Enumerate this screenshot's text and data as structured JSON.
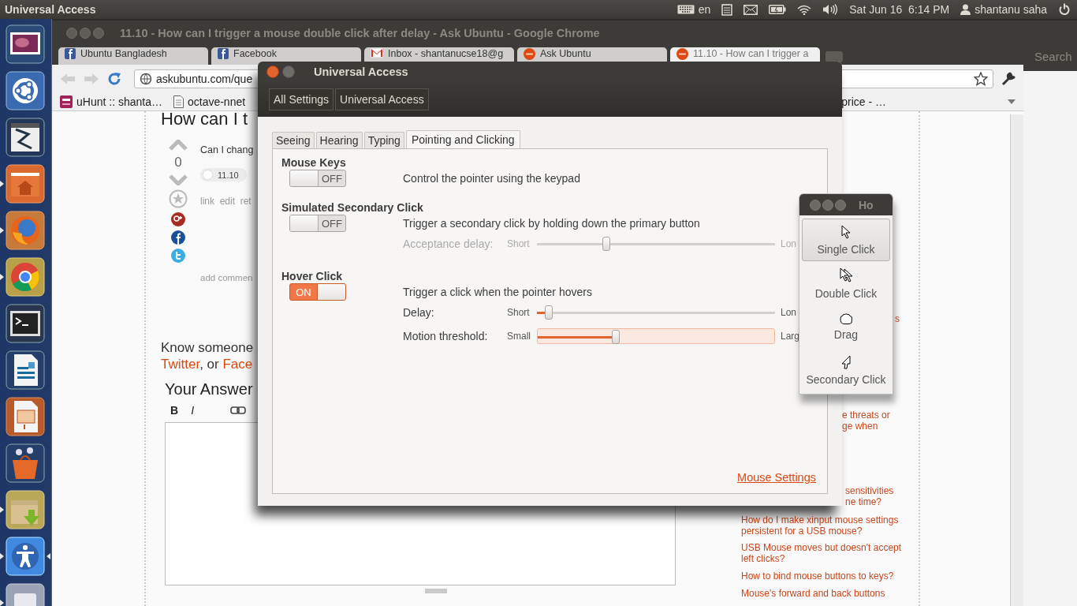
{
  "top_panel": {
    "app_title": "Universal Access",
    "keyboard_layout": "en",
    "clock": "Sat Jun 16  6:14 PM",
    "user": "shantanu saha"
  },
  "launcher": [
    {
      "kind": "workspaces",
      "running": false,
      "focused": false
    },
    {
      "kind": "dash",
      "running": false,
      "focused": false
    },
    {
      "kind": "remote",
      "running": false,
      "focused": false
    },
    {
      "kind": "files",
      "running": true,
      "focused": false
    },
    {
      "kind": "firefox",
      "running": true,
      "focused": false
    },
    {
      "kind": "chrome",
      "running": true,
      "focused": false
    },
    {
      "kind": "terminal",
      "running": false,
      "focused": false
    },
    {
      "kind": "writer",
      "running": false,
      "focused": false
    },
    {
      "kind": "impress",
      "running": false,
      "focused": false
    },
    {
      "kind": "software",
      "running": false,
      "focused": false
    },
    {
      "kind": "archive",
      "running": true,
      "focused": false
    },
    {
      "kind": "accessibility",
      "running": true,
      "focused": true
    },
    {
      "kind": "drive",
      "running": true,
      "focused": false
    }
  ],
  "browser": {
    "title": "11.10 - How can I trigger a mouse double click after delay - Ask Ubuntu - Google Chrome",
    "tabs": [
      {
        "label": "Ubuntu Bangladesh",
        "selected": false
      },
      {
        "label": "Facebook",
        "selected": false
      },
      {
        "label": "Inbox - shantanucse18@g",
        "selected": false
      },
      {
        "label": "Ask Ubuntu",
        "selected": false
      },
      {
        "label": "11.10 - How can I trigger a",
        "selected": true
      }
    ],
    "address": "askubuntu.com/que",
    "bookmarks": [
      "uHunt :: shanta…",
      "octave-nnet",
      "price - …"
    ],
    "question": {
      "heading": "How can I t",
      "votes": "0",
      "body": "Can I chang",
      "tag": "11.10",
      "actions": "link  edit  ret",
      "comment": "add commen"
    },
    "share_text": "Know someone",
    "share_links": [
      "Twitter",
      "Face"
    ],
    "share_joiner": ", or ",
    "answer_heading": "Your Answer",
    "editor_buttons": [
      "B",
      "I"
    ],
    "sidebar": [
      {
        "kind": "fragment",
        "text": "s"
      },
      {
        "kind": "fragment",
        "text": "e threats or\nge when"
      },
      {
        "kind": "fragment",
        "text": "sensitivities\nne time?"
      },
      {
        "kind": "link",
        "text": "How do I make xinput mouse settings persistent for a USB mouse?"
      },
      {
        "kind": "link",
        "text": "USB Mouse moves but doesn't accept left clicks?"
      },
      {
        "kind": "link",
        "text": "How to bind mouse buttons to keys?"
      },
      {
        "kind": "link",
        "text": "Mouse's forward and back buttons"
      }
    ]
  },
  "background_window": {
    "search": "Search"
  },
  "dialog": {
    "title": "Universal Access",
    "breadcrumbs": [
      "All Settings",
      "Universal Access"
    ],
    "tabs": [
      {
        "label": "Seeing",
        "selected": false
      },
      {
        "label": "Hearing",
        "selected": false
      },
      {
        "label": "Typing",
        "selected": false
      },
      {
        "label": "Pointing and Clicking",
        "selected": true
      }
    ],
    "sections": [
      {
        "title": "Mouse Keys",
        "on": false,
        "switch_label": "OFF",
        "description": "Control the pointer using the keypad"
      },
      {
        "title": "Simulated Secondary Click",
        "on": false,
        "switch_label": "OFF",
        "description": "Trigger a secondary click by holding down the primary button",
        "sliders": [
          {
            "label": "Acceptance delay:",
            "min": "Short",
            "max": "Lon",
            "level": 0.29,
            "disabled": true,
            "focused": false
          }
        ]
      },
      {
        "title": "Hover Click",
        "on": true,
        "switch_label": "ON",
        "description": "Trigger a click when the pointer hovers",
        "sliders": [
          {
            "label": "Delay:",
            "min": "Short",
            "max": "Lon",
            "level": 0.05,
            "disabled": false,
            "focused": false
          },
          {
            "label": "Motion threshold:",
            "min": "Small",
            "max": "Larg",
            "level": 0.33,
            "disabled": false,
            "focused": true
          }
        ]
      }
    ],
    "link": "Mouse Settings"
  },
  "hover_window": {
    "title": "Ho",
    "buttons": [
      {
        "label": "Single Click",
        "kind": "single",
        "selected": true
      },
      {
        "label": "Double Click",
        "kind": "double",
        "selected": false
      },
      {
        "label": "Drag",
        "kind": "drag",
        "selected": false
      },
      {
        "label": "Secondary Click",
        "kind": "secondary",
        "selected": false
      }
    ]
  }
}
